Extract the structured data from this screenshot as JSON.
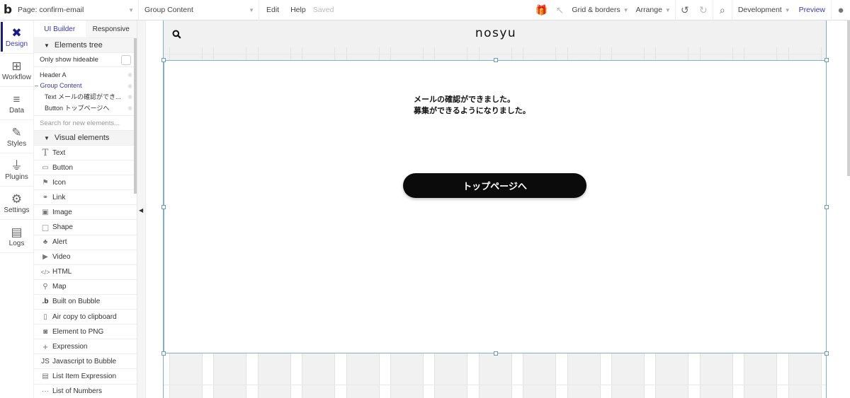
{
  "topbar": {
    "logo": "b",
    "page_select": "Page: confirm-email",
    "element_select": "Group Content",
    "edit": "Edit",
    "help": "Help",
    "saved": "Saved",
    "gift_icon": "gift-icon",
    "pointer_icon": "pointer-icon",
    "grid_borders": "Grid & borders",
    "arrange": "Arrange",
    "undo_icon": "↺",
    "redo_icon": "↻",
    "search_icon": "⚲",
    "environment": "Development",
    "preview": "Preview",
    "account_icon": "●"
  },
  "rail": {
    "items": [
      {
        "label": "Design",
        "icon": "✖"
      },
      {
        "label": "Workflow",
        "icon": "⊞"
      },
      {
        "label": "Data",
        "icon": "≡"
      },
      {
        "label": "Styles",
        "icon": "✎"
      },
      {
        "label": "Plugins",
        "icon": "⏚"
      },
      {
        "label": "Settings",
        "icon": "⚙"
      },
      {
        "label": "Logs",
        "icon": "▤"
      }
    ]
  },
  "panel": {
    "tabs": [
      "UI Builder",
      "Responsive"
    ],
    "elements_tree_title": "Elements tree",
    "only_show_hideable": "Only show hideable",
    "tree": [
      {
        "label": "Header A"
      },
      {
        "label": "– Group Content"
      },
      {
        "label": "Text メールの確認ができ..."
      },
      {
        "label": "Button トップページへ"
      }
    ],
    "search_placeholder": "Search for new elements...",
    "visual_elements_title": "Visual elements",
    "elements": [
      {
        "label": "Text",
        "icon": "T"
      },
      {
        "label": "Button",
        "icon": "▭"
      },
      {
        "label": "Icon",
        "icon": "⚑"
      },
      {
        "label": "Link",
        "icon": "⚭"
      },
      {
        "label": "Image",
        "icon": "▣"
      },
      {
        "label": "Shape",
        "icon": "□"
      },
      {
        "label": "Alert",
        "icon": "♣"
      },
      {
        "label": "Video",
        "icon": "▶"
      },
      {
        "label": "HTML",
        "icon": "</>"
      },
      {
        "label": "Map",
        "icon": "⚲"
      },
      {
        "label": "Built on Bubble",
        "icon": ".b"
      },
      {
        "label": "Air copy to clipboard",
        "icon": "▯"
      },
      {
        "label": "Element to PNG",
        "icon": "◙"
      },
      {
        "label": "Expression",
        "icon": "+"
      },
      {
        "label": "Javascript to Bubble",
        "icon": "JS"
      },
      {
        "label": "List Item Expression",
        "icon": "▤"
      },
      {
        "label": "List of Numbers",
        "icon": "···"
      }
    ]
  },
  "canvas": {
    "header_search_icon": "🔍",
    "brand": "nosyu",
    "message_line1": "メールの確認ができました。",
    "message_line2": "募集ができるようになりました。",
    "button_label": "トップページへ"
  }
}
